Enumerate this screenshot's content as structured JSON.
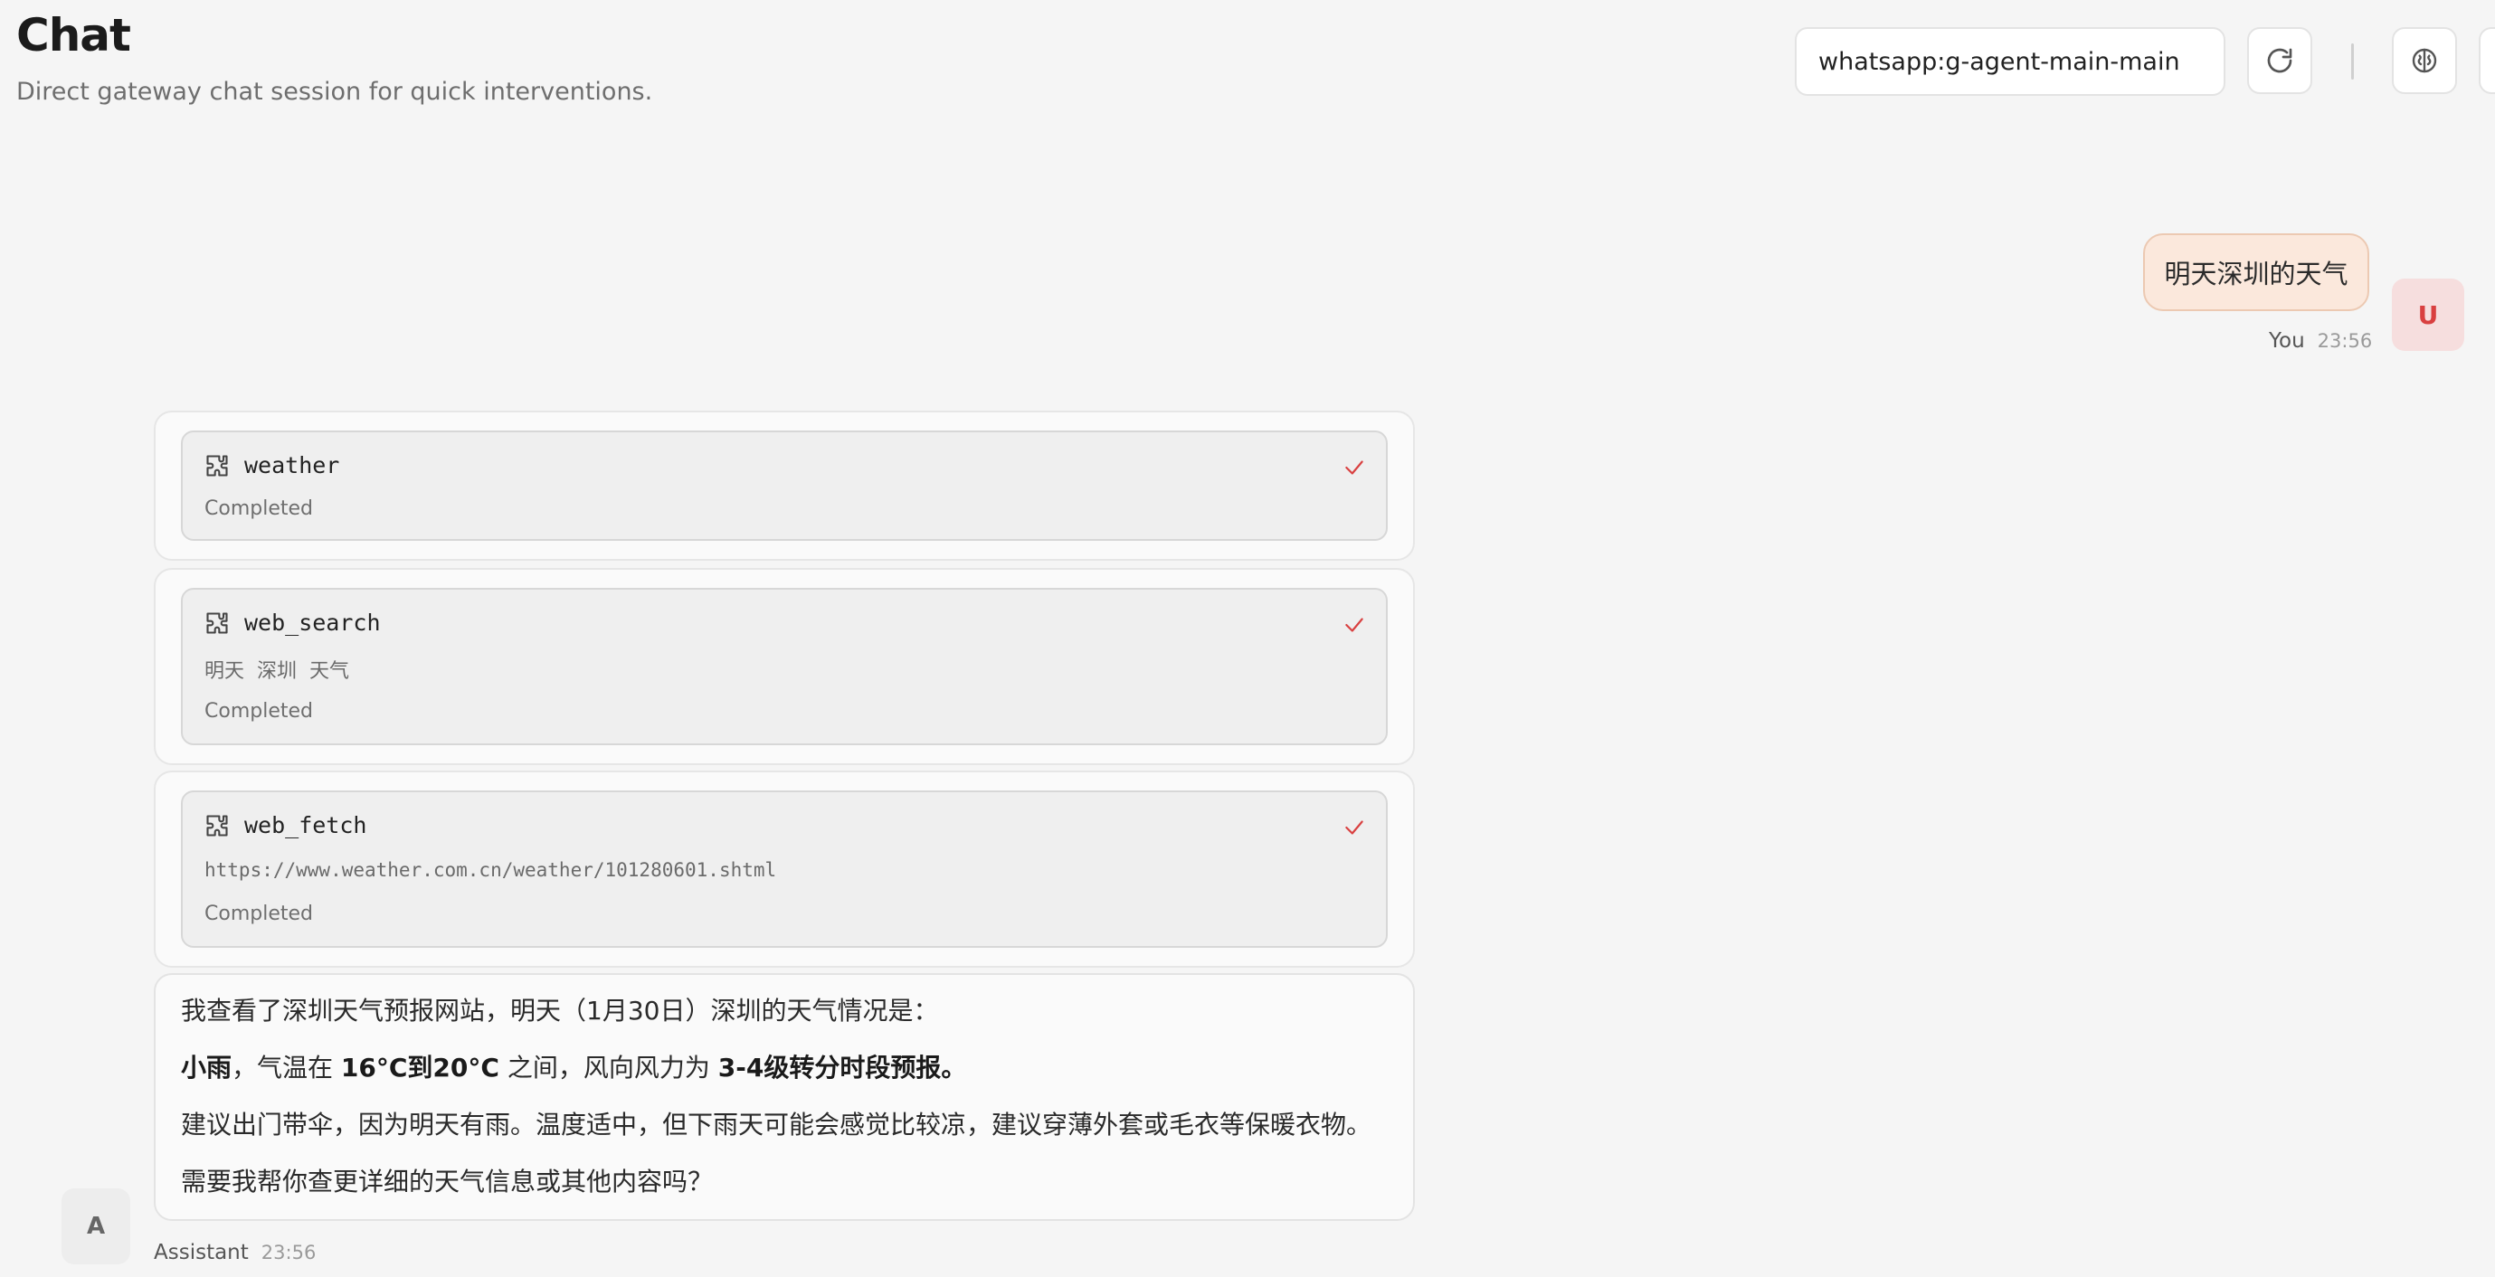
{
  "header": {
    "title": "Chat",
    "subtitle": "Direct gateway chat session for quick interventions.",
    "session_value": "whatsapp:g-agent-main-main",
    "refresh_icon": "refresh-icon",
    "brain_icon": "brain-icon"
  },
  "user_message": {
    "text": "明天深圳的天气",
    "avatar": "U",
    "sender": "You",
    "time": "23:56"
  },
  "tools": [
    {
      "name": "weather",
      "args": "",
      "status": "Completed",
      "icon": "puzzle-icon",
      "check_icon": "check-icon"
    },
    {
      "name": "web_search",
      "args": "明天  深圳  天气",
      "status": "Completed",
      "icon": "puzzle-icon",
      "check_icon": "check-icon"
    },
    {
      "name": "web_fetch",
      "args": "https://www.weather.com.cn/weather/101280601.shtml",
      "status": "Completed",
      "icon": "puzzle-icon",
      "check_icon": "check-icon"
    }
  ],
  "assistant_message": {
    "line1": "我查看了深圳天气预报网站，明天（1月30日）深圳的天气情况是：",
    "line2_a": "小雨",
    "line2_b": "，气温在 ",
    "line2_c": "16°C到20°C",
    "line2_d": " 之间，风向风力为 ",
    "line2_e": "3-4级转分时段预报。",
    "line3": "建议出门带伞，因为明天有雨。温度适中，但下雨天可能会感觉比较凉，建议穿薄外套或毛衣等保暖衣物。",
    "line4": "需要我帮你查更详细的天气信息或其他内容吗？",
    "avatar": "A",
    "sender": "Assistant",
    "time": "23:56"
  },
  "colors": {
    "accent": "#d94040",
    "user_bubble": "#fbe8dc",
    "background": "#f5f5f5"
  }
}
